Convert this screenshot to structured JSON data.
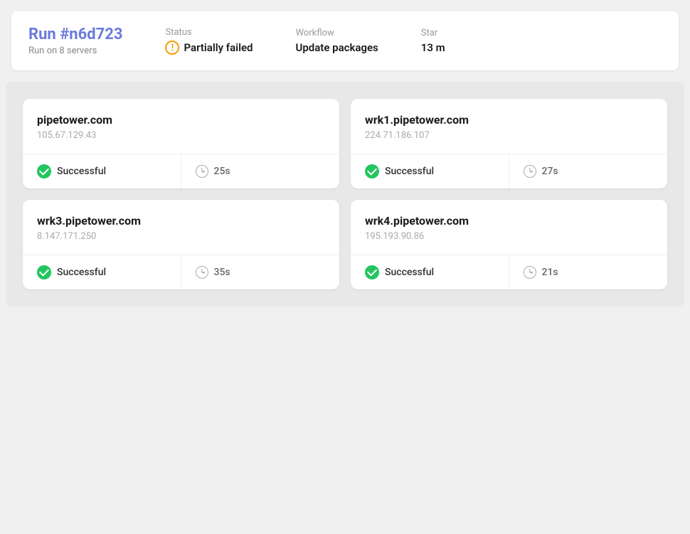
{
  "topbar": {
    "run_label": "Run",
    "run_id": "#n6d723",
    "run_subtitle": "Run on 8 servers",
    "status_label": "Status",
    "status_value": "Partially failed",
    "workflow_label": "Workflow",
    "workflow_value": "Update packages",
    "started_label": "Star",
    "started_value": "13 m"
  },
  "servers": [
    {
      "name": "pipetower.com",
      "ip": "105.67.129.43",
      "status": "Successful",
      "duration": "25s"
    },
    {
      "name": "wrk1.pipetower.com",
      "ip": "224.71.186.107",
      "status": "Successful",
      "duration": "27s"
    },
    {
      "name": "wrk3.pipetower.com",
      "ip": "8.147.171.250",
      "status": "Successful",
      "duration": "35s"
    },
    {
      "name": "wrk4.pipetower.com",
      "ip": "195.193.90.86",
      "status": "Successful",
      "duration": "21s"
    }
  ]
}
